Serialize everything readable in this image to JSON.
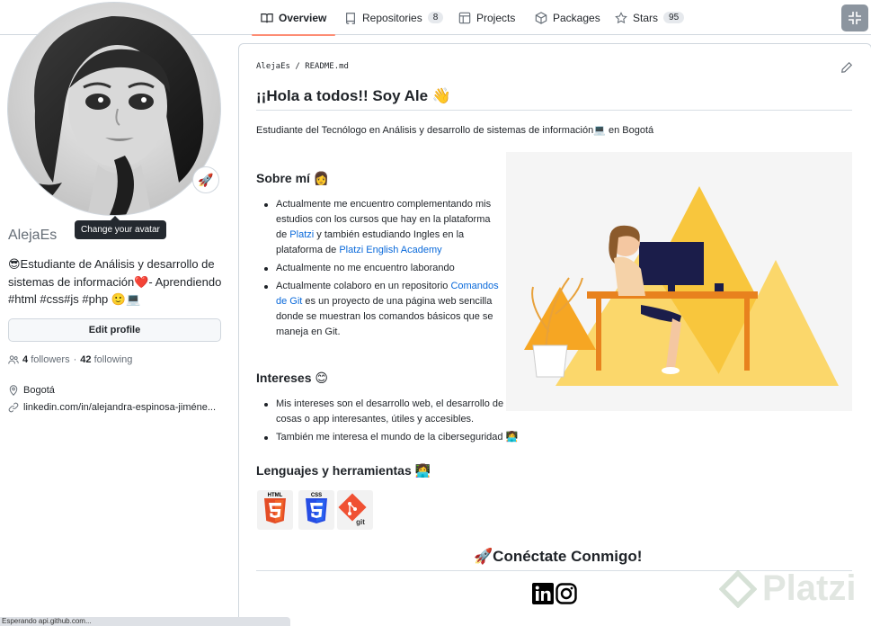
{
  "nav": {
    "tabs": [
      {
        "label": "Overview",
        "icon": "book-icon"
      },
      {
        "label": "Repositories",
        "icon": "repo-icon",
        "count": "8"
      },
      {
        "label": "Projects",
        "icon": "table-icon"
      },
      {
        "label": "Packages",
        "icon": "package-icon"
      },
      {
        "label": "Stars",
        "icon": "star-icon",
        "count": "95"
      }
    ],
    "accent": "#fd8c73"
  },
  "profile": {
    "avatar_tooltip": "Change your avatar",
    "username": "AlejaEs",
    "bio": "😎Estudiante de Análisis y desarrollo de sistemas de información❤️- Aprendiendo #html #css#js #php 🙂💻",
    "edit_label": "Edit profile",
    "followers_count": "4",
    "followers_label": "followers",
    "separator": "·",
    "following_count": "42",
    "following_label": "following",
    "location": "Bogotá",
    "linkedin": "linkedin.com/in/alejandra-espinosa-jiméne..."
  },
  "readme": {
    "path_user": "AlejaEs",
    "path_sep": "/",
    "path_file": "README.md",
    "title": "¡¡Hola a todos!! Soy Ale 👋",
    "intro": "Estudiante del Tecnólogo en Análisis y desarrollo de sistemas de información💻 en Bogotá",
    "about_heading": "Sobre mí 👩",
    "about_items": {
      "item1_a": "Actualmente me encuentro complementando mis estudios con los cursos que hay en la plataforma de ",
      "item1_link1": "Platzi",
      "item1_b": " y también estudiando Ingles en la plataforma de ",
      "item1_link2": "Platzi English Academy",
      "item2": "Actualmente no me encuentro laborando",
      "item3_a": "Actualmente colaboro en un repositorio ",
      "item3_link": "Comandos de Git",
      "item3_b": " es un proyecto de una página web sencilla donde se muestran los comandos básicos que se maneja en Git."
    },
    "interests_heading": "Intereses 😊",
    "interests_items": [
      "Mis intereses son el desarrollo web, el desarrollo de cosas o app interesantes, útiles y accesibles.",
      "También me interesa el mundo de la ciberseguridad 👩‍💻"
    ],
    "langs_heading": "Lenguajes y herramientas 👩‍💻",
    "badges": [
      "HTML",
      "CSS",
      "git"
    ],
    "connect_heading": "🚀Conéctate Conmigo!"
  },
  "watermark": "Platzi",
  "statusbar": "Esperando api.github.com..."
}
